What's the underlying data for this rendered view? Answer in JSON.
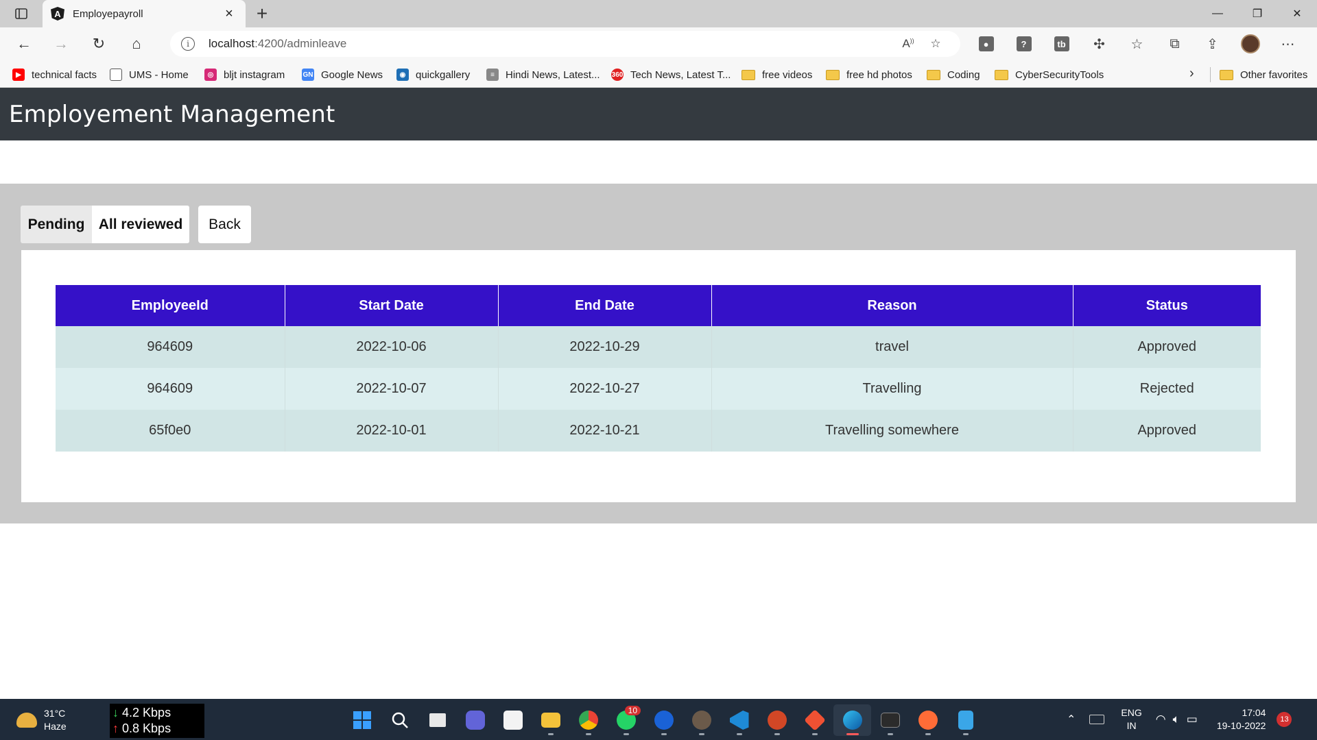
{
  "browser": {
    "tab": {
      "title": "Employepayroll",
      "favicon_icon": "angular-icon"
    },
    "address_bar": {
      "host": "localhost",
      "path": ":4200/adminleave"
    },
    "bookmarks": [
      {
        "label": "technical facts",
        "icon": "youtube-icon",
        "color": "#ff0000"
      },
      {
        "label": "UMS - Home",
        "icon": "page-icon",
        "color": "#ffffff"
      },
      {
        "label": "bljt instagram",
        "icon": "instagram-icon",
        "color": "#d62976"
      },
      {
        "label": "Google News",
        "icon": "google-news-icon",
        "color": "#4285f4"
      },
      {
        "label": "quickgallery",
        "icon": "camera-icon",
        "color": "#1f6fb5"
      },
      {
        "label": "Hindi News, Latest...",
        "icon": "news-icon",
        "color": "#888888"
      },
      {
        "label": "Tech News, Latest T...",
        "icon": "tech360-icon",
        "color": "#e02020"
      },
      {
        "label": "free videos",
        "icon": "folder-icon"
      },
      {
        "label": "free hd photos",
        "icon": "folder-icon"
      },
      {
        "label": "Coding",
        "icon": "folder-icon"
      },
      {
        "label": "CyberSecurityTools",
        "icon": "folder-icon"
      }
    ],
    "other_favorites": "Other favorites"
  },
  "app": {
    "title": "Employement Management",
    "tabs": {
      "pending": "Pending",
      "reviewed": "All reviewed"
    },
    "back_label": "Back",
    "table": {
      "headers": [
        "EmployeeId",
        "Start Date",
        "End Date",
        "Reason",
        "Status"
      ],
      "rows": [
        [
          "964609",
          "2022-10-06",
          "2022-10-29",
          "travel",
          "Approved"
        ],
        [
          "964609",
          "2022-10-07",
          "2022-10-27",
          "Travelling",
          "Rejected"
        ],
        [
          "65f0e0",
          "2022-10-01",
          "2022-10-21",
          "Travelling somewhere",
          "Approved"
        ]
      ]
    },
    "colors": {
      "header_bg": "#343a40",
      "table_header_bg": "#3511c8",
      "area_bg": "#c8c8c8"
    }
  },
  "taskbar": {
    "weather": {
      "temp": "31°C",
      "condition": "Haze"
    },
    "net": {
      "down": "4.2 Kbps",
      "up": "0.8 Kbps"
    },
    "whatsapp_badge": "10",
    "lang": {
      "line1": "ENG",
      "line2": "IN"
    },
    "clock": {
      "time": "17:04",
      "date": "19-10-2022"
    },
    "notifications": "13"
  }
}
